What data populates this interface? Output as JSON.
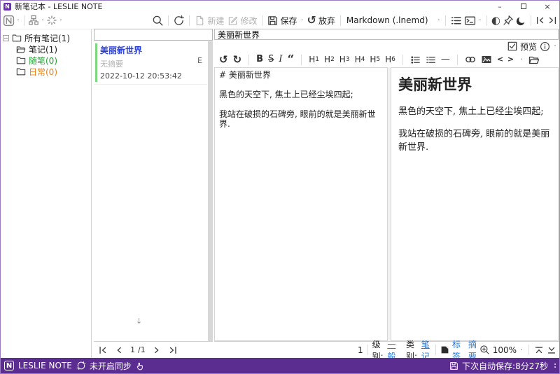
{
  "window": {
    "title": "新笔记本 - LESLIE NOTE",
    "minimize": "–",
    "close": "×"
  },
  "toolbar": {
    "new_label": "新建",
    "modify_label": "修改",
    "save_label": "保存",
    "discard_label": "放弃",
    "format_selector": "Markdown (.lnemd)"
  },
  "sidebar": {
    "items": [
      {
        "label": "所有笔记(1)",
        "color": "#1d1d1d"
      },
      {
        "label": "笔记(1)",
        "color": "#1d1d1d"
      },
      {
        "label": "随笔(0)",
        "color": "#23a032"
      },
      {
        "label": "日常(0)",
        "color": "#e8821e"
      }
    ]
  },
  "note_list": {
    "filter_value": "",
    "note": {
      "title": "美丽新世界",
      "summary": "无摘要",
      "datetime": "2022-10-12 20:53:42",
      "badge": "E",
      "title_color": "#2b3fd9",
      "accent_color": "#7dd87d"
    },
    "page_current": "1",
    "page_total": "/1"
  },
  "editor": {
    "title_value": "美丽新世界",
    "preview_label": "预览",
    "md": {
      "bold": "B",
      "strike": "S",
      "italic": "I",
      "quote": "“",
      "h_letter": "H",
      "h_digits": [
        "1",
        "2",
        "3",
        "4",
        "5",
        "6"
      ],
      "hr": "—",
      "code": "< >"
    },
    "source_lines": [
      "# 美丽新世界",
      "",
      "黑色的天空下, 焦土上已经尘埃四起;",
      "",
      "我站在破损的石碑旁, 眼前的就是美丽新世界."
    ],
    "preview": {
      "heading": "美丽新世界",
      "para1": "黑色的天空下, 焦土上已经尘埃四起;",
      "para2": "我站在破损的石碑旁, 眼前的就是美丽新世界."
    }
  },
  "bottom": {
    "line_indicator": "1",
    "level_label": "级别:",
    "level_value": "一般",
    "category_label": "类别:",
    "category_value": "笔记",
    "tags_label": "标签",
    "summary_label": "摘要",
    "zoom_value": "100%",
    "link_color": "#2878d8"
  },
  "status": {
    "app_name": "LESLIE NOTE",
    "sync_status": "未开启同步",
    "autosave": "下次自动保存:8分27秒",
    "bg_color": "#5b2d90"
  },
  "icons": {
    "app_logo": "N",
    "undo": "↺",
    "redo": "↻",
    "discard": "↺",
    "contrast": "◐",
    "down_arrow": "↓",
    "map": {
      "search-icon": "magnifier",
      "refresh-icon": "circular-arrow",
      "new-note-icon": "document",
      "edit-icon": "pencil-square",
      "save-icon": "floppy",
      "discard-icon": "undo-arrow",
      "outline-icon": "bullet-list",
      "terminal-icon": "prompt-window",
      "contrast-icon": "half-circle",
      "pin-icon": "pushpin",
      "dark-mode-icon": "crescent-moon",
      "collapse-left-icon": "bar-chevron-left",
      "collapse-right-icon": "bar-chevron-right",
      "info-icon": "circle-i",
      "link-icon": "chain-rings",
      "image-icon": "picture",
      "folder-open-icon": "open-folder",
      "bookmark-icon": "tag-square",
      "zoom-in-icon": "magnifier-plus",
      "scroll-top-icon": "bar-chevron-up",
      "scroll-bottom-icon": "bar-chevron-down",
      "sync-icon": "circular-arrows",
      "touch-icon": "hand",
      "tree-icon": "hierarchy",
      "sparkle-icon": "starburst"
    }
  }
}
